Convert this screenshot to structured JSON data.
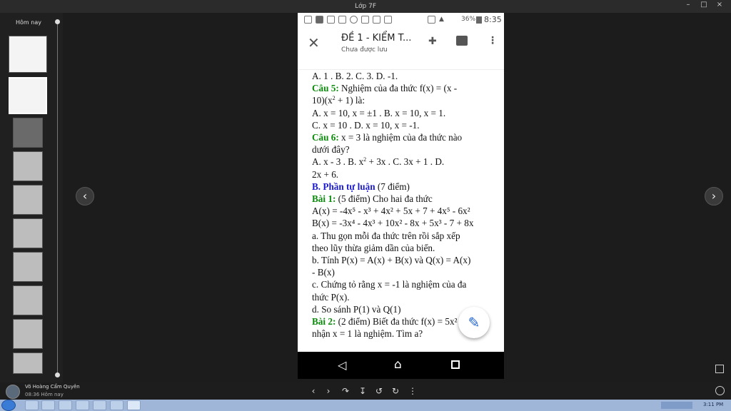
{
  "window": {
    "title": "Lớp 7F",
    "min": "–",
    "max": "□",
    "close": "×"
  },
  "sidebar": {
    "today_label": "Hôm nay"
  },
  "phone": {
    "status": {
      "battery": "36%",
      "time": "8:35"
    },
    "appbar": {
      "title": "ĐỀ 1 - KIỂM T...",
      "subtitle": "Chưa được lưu"
    },
    "document": {
      "l1": "A. 1 .     B. 2.      C. 3.      D. -1.",
      "c5_label": "Câu 5:",
      "c5_text": " Nghiệm của đa thức f(x) = (x -",
      "c5_l2a": "10)(x",
      "c5_l2b": " + 1) là:",
      "c5_a": "A. x = 10, x = ±1  .          B. x = 10, x = 1.",
      "c5_c": "C. x = 10  .               D. x = 10, x = -1.",
      "c6_label": "Câu 6:",
      "c6_text": " x = 3 là nghiệm của đa thức nào",
      "c6_l2": "dưới đây?",
      "c6_a1": "A. x - 3 .    B. x",
      "c6_a2": " + 3x .   C. 3x + 1 .     D.",
      "c6_l4": "2x + 6.",
      "partB_label": "B. Phần tự luận",
      "partB_pts": " (7 điểm)",
      "b1_label": "Bài 1:",
      "b1_text": " (5 điểm) Cho hai đa thức",
      "ax": "A(x) = -4x⁵ - x³ + 4x² + 5x + 7 + 4x⁵ - 6x²",
      "bx": "B(x) = -3x⁴ - 4x³ + 10x² - 8x + 5x³ - 7 + 8x",
      "qa1": "a. Thu gọn mỗi đa thức trên rồi sắp xếp",
      "qa2": "theo lũy thừa giảm dần của biến.",
      "qb1": "b. Tính P(x) = A(x) + B(x) và Q(x) = A(x)",
      "qb2": "- B(x)",
      "qc1": "c. Chứng tỏ rằng x = -1 là nghiệm của đa",
      "qc2": "thức P(x).",
      "qd": "d. So sánh P(1) và Q(1)",
      "b2_label": "Bài 2:",
      "b2_text": " (2 điểm) Biết đa thức f(x) = 5x² - x",
      "b2_l2": "nhận x = 1 là nghiệm. Tìm a?"
    }
  },
  "footer": {
    "user_name": "Võ Hoàng Cẩm Quyên",
    "timestamp": "08:36 Hôm nay"
  },
  "taskbar": {
    "clock": "3:11 PM"
  }
}
